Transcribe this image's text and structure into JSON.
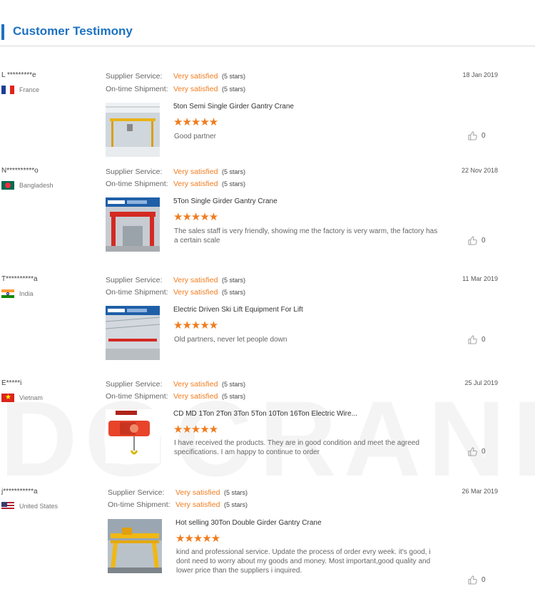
{
  "section_title": "Customer Testimony",
  "watermark": "DGCRANE",
  "labels": {
    "supplier_service": "Supplier Service:",
    "on_time_shipment": "On-time Shipment:"
  },
  "colors": {
    "accent": "#1d72c0",
    "rating": "#f07c1f"
  },
  "reviews": [
    {
      "buyer": "L *********e",
      "country": "France",
      "date": "18 Jan 2019",
      "supplier_service": "Very satisfied",
      "supplier_stars": "(5 stars)",
      "shipment": "Very satisfied",
      "shipment_stars": "(5 stars)",
      "product": "5ton Semi Single Girder Gantry Crane",
      "rating": "★★★★★",
      "comment": "Good partner",
      "likes": "0"
    },
    {
      "buyer": "N**********o",
      "country": "Bangladesh",
      "date": "22 Nov 2018",
      "supplier_service": "Very satisfied",
      "supplier_stars": "(5 stars)",
      "shipment": "Very satisfied",
      "shipment_stars": "(5 stars)",
      "product": "5Ton Single Girder Gantry Crane",
      "rating": "★★★★★",
      "comment": "The sales staff is very friendly, showing me the factory is very warm, the factory has a certain scale",
      "likes": "0"
    },
    {
      "buyer": "T**********a",
      "country": "India",
      "date": "11 Mar 2019",
      "supplier_service": "Very satisfied",
      "supplier_stars": "(5 stars)",
      "shipment": "Very satisfied",
      "shipment_stars": "(5 stars)",
      "product": "Electric Driven Ski Lift Equipment For Lift",
      "rating": "★★★★★",
      "comment": "Old partners, never let people down",
      "likes": "0"
    },
    {
      "buyer": "E*****i",
      "country": "Vietnam",
      "date": "25 Jul 2019",
      "supplier_service": "Very satisfied",
      "supplier_stars": "(5 stars)",
      "shipment": "Very satisfied",
      "shipment_stars": "(5 stars)",
      "product": "CD MD 1Ton 2Ton 3Ton 5Ton 10Ton 16Ton Electric Wire...",
      "rating": "★★★★★",
      "comment": "I have received the products. They are in good condition and meet the agreed specifications. I am happy to continue to order",
      "likes": "0"
    },
    {
      "buyer": "j***********a",
      "country": "United States",
      "date": "26 Mar 2019",
      "supplier_service": "Very satisfied",
      "supplier_stars": "(5 stars)",
      "shipment": "Very satisfied",
      "shipment_stars": "(5 stars)",
      "product": "Hot selling 30Ton Double Girder Gantry Crane",
      "rating": "★★★★★",
      "comment": "kind and professional service. Update the process of order evry week. it's good, i dont need to worry about my goods and money. Most important,good quality and lower price than the suppliers i inquired.",
      "likes": "0"
    }
  ]
}
